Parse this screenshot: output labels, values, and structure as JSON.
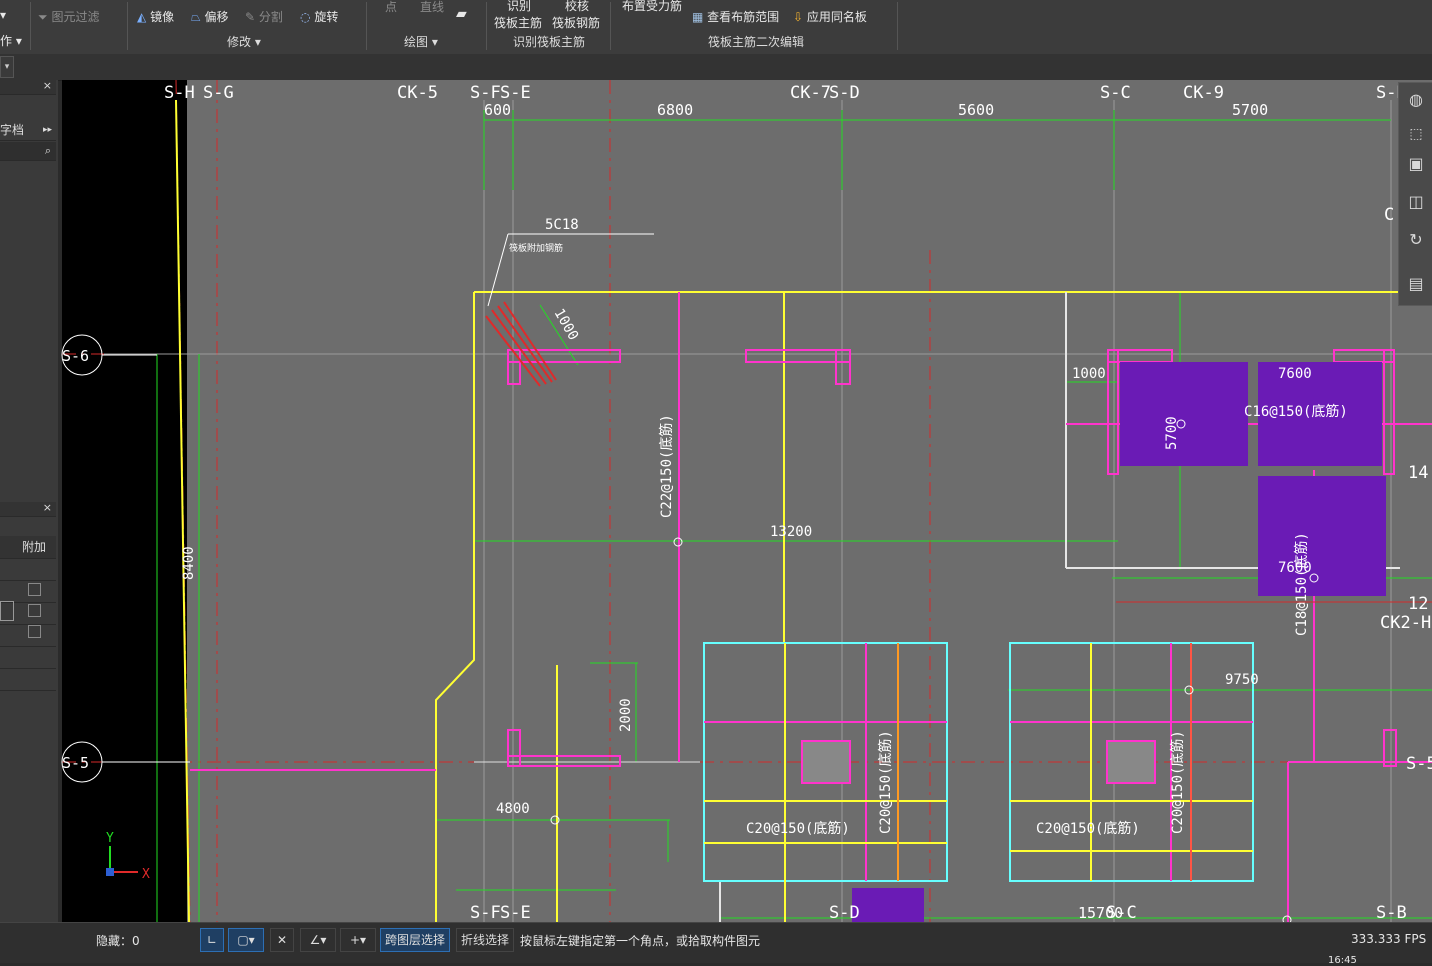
{
  "ribbon": {
    "left_cut_1": "▾",
    "left_cut_2": "作 ▾",
    "filter": "图元过滤",
    "mirror": "镜像",
    "offset": "偏移",
    "split": "分割",
    "rotate": "旋转",
    "modify_group": "修改 ▾",
    "point": "点",
    "line": "直线",
    "draw_group": "绘图 ▾",
    "identify_top": "识别",
    "identify_bottom": "筏板主筋",
    "check_top": "校核",
    "check_bottom": "筏板钢筋",
    "identify_group": "识别筏板主筋",
    "layout_force_rebar": "布置受力筋",
    "view_range": "查看布筋范围",
    "apply_same_name": "应用同名板",
    "edit_group": "筏板主筋二次编辑"
  },
  "left_panel": {
    "close1": "×",
    "doc_label": "字档",
    "arrows": "▸▸",
    "search": "⌕",
    "close2": "×",
    "col_header": "附加"
  },
  "drawing": {
    "axis_labels_top": [
      "S-H",
      "S-G",
      "CK-5",
      "S-F",
      "S-E",
      "CK-7",
      "S-D",
      "S-C",
      "CK-9",
      "S-B"
    ],
    "dims_top": [
      "600",
      "6800",
      "5600",
      "5700"
    ],
    "bubbles_left": [
      "S-6",
      "S-5"
    ],
    "right_labels": [
      "14",
      "12",
      "CK2-H",
      "S-5",
      "C"
    ],
    "annotations": {
      "rebar_5c18": "5C18",
      "rebar_note": "筏板附加钢筋",
      "dim_1000_diag": "1000",
      "c22": "C22@150(底筋)",
      "dim_13200": "13200",
      "dim_8400": "8400",
      "dim_1000": "1000",
      "dim_7600a": "7600",
      "dim_5700": "5700",
      "c16": "C16@150(底筋)",
      "dim_7600b": "7600",
      "c18": "C18@150(底筋)",
      "dim_2000": "2000",
      "dim_9750": "9750",
      "dim_4800": "4800",
      "c20_1": "C20@150(底筋)",
      "c20_2": "C20@150(底筋)",
      "c20_3": "C20@150(底筋)",
      "c20_4": "C20@150(底筋)"
    },
    "bottom_labels": [
      "S-F",
      "S-E",
      "S-D",
      "15700",
      "S-C",
      "S-B"
    ],
    "axis_x": "X",
    "axis_y": "Y"
  },
  "status": {
    "hidden_label": "隐藏：0",
    "cross_layer": "跨图层选择",
    "polyline": "折线选择",
    "hint": "按鼠标左键指定第一个角点，或拾取构件图元",
    "fps": "333.333 FPS",
    "clock": "16:45"
  },
  "colors": {
    "canvas_bg": "#6d6d6d",
    "axis_red": "#d42a2a",
    "grid_green": "#22dd22",
    "yellow": "#ffff33",
    "magenta": "#ff33cc",
    "cyan": "#66ffff",
    "purple": "#6a1bb5",
    "active_blue": "#2d6fb4"
  }
}
